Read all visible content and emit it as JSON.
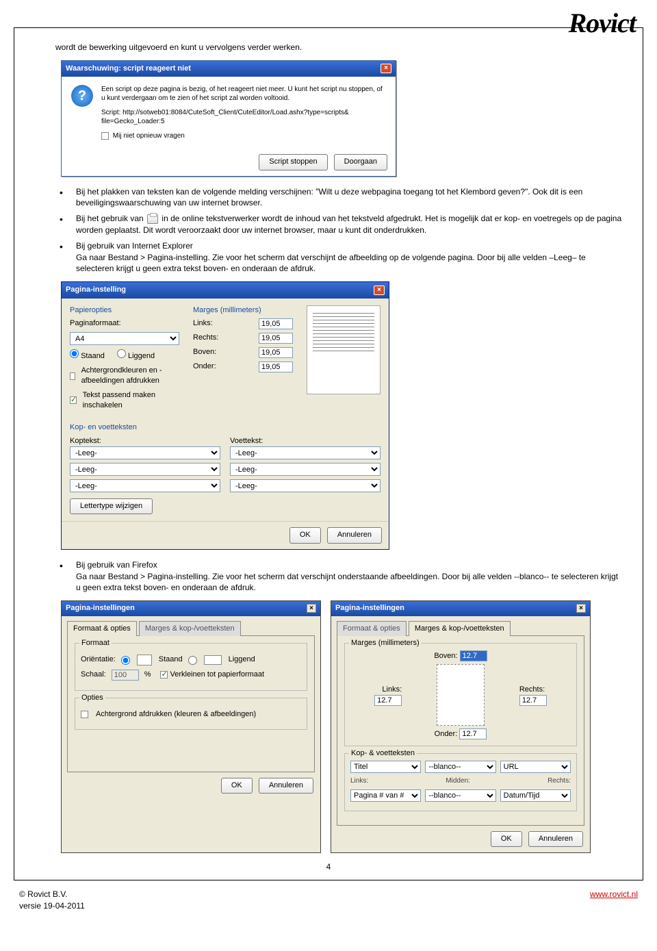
{
  "logo": "Rovict",
  "intro_text": "wordt de bewerking uitgevoerd en kunt u vervolgens verder werken.",
  "warning_dialog": {
    "title": "Waarschuwing: script reageert niet",
    "msg1": "Een script op deze pagina is bezig, of het reageert niet meer. U kunt het script nu stoppen, of u kunt verdergaan om te zien of het script zal worden voltooid.",
    "script_line": "Script: http://sotweb01:8084/CuteSoft_Client/CuteEditor/Load.ashx?type=scripts&\nfile=Gecko_Loader:5",
    "checkbox": "Mij niet opnieuw vragen",
    "btn_stop": "Script stoppen",
    "btn_continue": "Doorgaan"
  },
  "bullets1": [
    "Bij het plakken van teksten kan de volgende melding verschijnen: \"Wilt u deze webpagina toegang tot het Klembord geven?\". Ook dit is een beveiligingswaarschuwing van uw internet browser.",
    "Bij het gebruik van __PRINTICON__ in de online tekstverwerker wordt de inhoud van het tekstveld afgedrukt. Het is mogelijk dat er kop- en voetregels op de pagina worden geplaatst. Dit wordt veroorzaakt door uw internet browser, maar u kunt dit onderdrukken.",
    "Bij gebruik van Internet Explorer\nGa naar Bestand > Pagina-instelling. Zie voor het scherm dat verschijnt de afbeelding op de volgende pagina. Door bij alle velden –Leeg– te selecteren krijgt u geen extra tekst boven- en onderaan de afdruk."
  ],
  "ie_dialog": {
    "title": "Pagina-instelling",
    "paper_label": "Papieropties",
    "page_format_label": "Paginaformaat:",
    "page_format_value": "A4",
    "orient_portrait": "Staand",
    "orient_landscape": "Liggend",
    "bg_print": "Achtergrondkleuren en -afbeeldingen afdrukken",
    "shrink": "Tekst passend maken inschakelen",
    "margins_label": "Marges (millimeters)",
    "margins": {
      "links": "19,05",
      "rechts": "19,05",
      "boven": "19,05",
      "onder": "19,05"
    },
    "margin_labels": {
      "links": "Links:",
      "rechts": "Rechts:",
      "boven": "Boven:",
      "onder": "Onder:"
    },
    "headers_label": "Kop- en voetteksten",
    "header_label": "Koptekst:",
    "footer_label": "Voettekst:",
    "hf_value": "-Leeg-",
    "font_btn": "Lettertype wijzigen",
    "ok": "OK",
    "cancel": "Annuleren"
  },
  "bullets2": [
    "Bij gebruik van Firefox\nGa naar Bestand > Pagina-instelling. Zie voor het scherm dat verschijnt onderstaande afbeeldingen. Door bij alle velden --blanco-- te selecteren krijgt u geen extra tekst boven- en onderaan de afdruk."
  ],
  "ff_left": {
    "title": "Pagina-instellingen",
    "tab1": "Formaat & opties",
    "tab2": "Marges & kop-/voetteksten",
    "format_group": "Formaat",
    "orient_label": "Oriëntatie:",
    "portrait": "Staand",
    "landscape": "Liggend",
    "scale_label": "Schaal:",
    "scale_value": "100",
    "percent": "%",
    "shrink": "Verkleinen tot papierformaat",
    "options_group": "Opties",
    "bg": "Achtergrond afdrukken (kleuren & afbeeldingen)",
    "ok": "OK",
    "cancel": "Annuleren"
  },
  "ff_right": {
    "title": "Pagina-instellingen",
    "tab1": "Formaat & opties",
    "tab2": "Marges & kop-/voetteksten",
    "margins_group": "Marges (millimeters)",
    "m": {
      "boven": "12.7",
      "links": "12.7",
      "rechts": "12.7",
      "onder": "12.7"
    },
    "ml": {
      "boven": "Boven:",
      "links": "Links:",
      "rechts": "Rechts:",
      "onder": "Onder:"
    },
    "kv_group": "Kop- & voetteksten",
    "sub_left": "Links:",
    "sub_mid": "Midden:",
    "sub_right": "Rechts:",
    "kv_titel": "Titel",
    "kv_blanco": "--blanco--",
    "kv_url": "URL",
    "kv_pagina": "Pagina # van #",
    "kv_datum": "Datum/Tijd",
    "ok": "OK",
    "cancel": "Annuleren"
  },
  "page_number": "4",
  "footer": {
    "left1": "© Rovict B.V.",
    "left2": "versie 19-04-2011",
    "right": "www.rovict.nl"
  }
}
